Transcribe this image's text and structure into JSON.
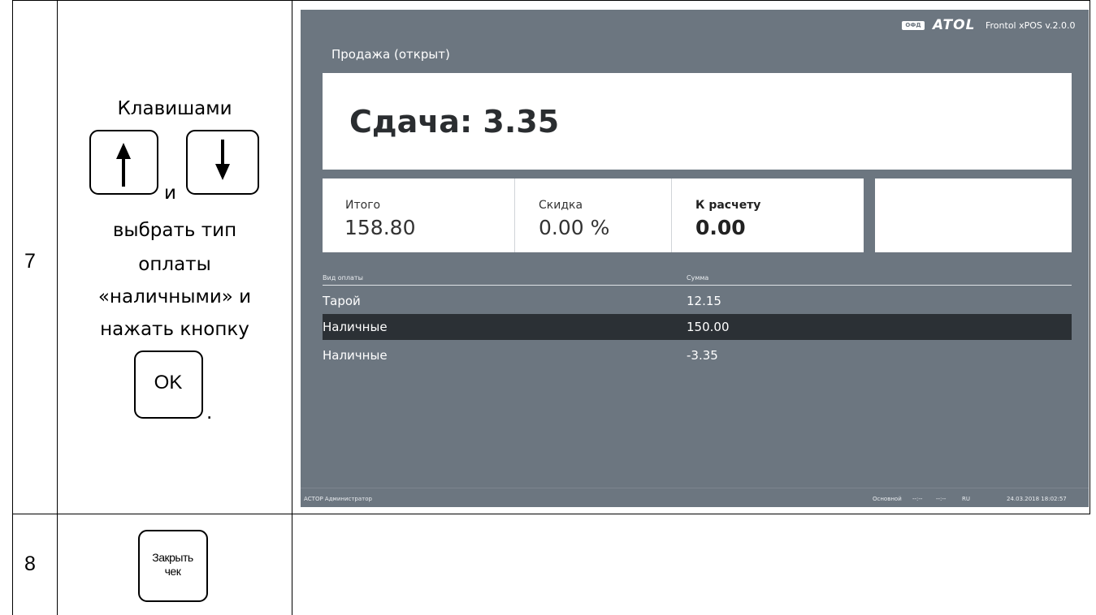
{
  "rows": [
    {
      "number": "7",
      "instruction": {
        "line1": "Клавишами",
        "and": "и",
        "line2": "выбрать тип",
        "line3": "оплаты",
        "line4": "«наличными» и",
        "line5": "нажать кнопку",
        "period": "."
      },
      "keys": [
        "up-arrow",
        "down-arrow",
        "ok"
      ],
      "ok_key_label": "OK"
    },
    {
      "number": "8",
      "key_label_line1": "Закрыть",
      "key_label_line2": "чек"
    }
  ],
  "pos": {
    "ofd_badge": "ОФД",
    "brand": "ATOL",
    "app_version": "Frontol xPOS v.2.0.0",
    "mode_title": "Продажа (открыт)",
    "change_text": "Сдача: 3.35",
    "totals": [
      {
        "label": "Итого",
        "value": "158.80"
      },
      {
        "label": "Скидка",
        "value": "0.00 %"
      },
      {
        "label": "К расчету",
        "value": "0.00"
      }
    ],
    "payments_header": {
      "type": "Вид оплаты",
      "sum": "Сумма"
    },
    "payments": [
      {
        "type": "Тарой",
        "sum": "12.15",
        "selected": false
      },
      {
        "type": "Наличные",
        "sum": "150.00",
        "selected": true
      },
      {
        "type": "Наличные",
        "sum": "-3.35",
        "selected": false
      }
    ],
    "status": {
      "user": "АСТОР  Администратор",
      "profile": "Основной",
      "field1": "--:--",
      "field2": "--:--",
      "lang": "RU",
      "datetime": "24.03.2018 18:02:57"
    },
    "colors": {
      "background": "#6c7680",
      "selected_row": "#2b3035",
      "card": "#ffffff"
    }
  }
}
